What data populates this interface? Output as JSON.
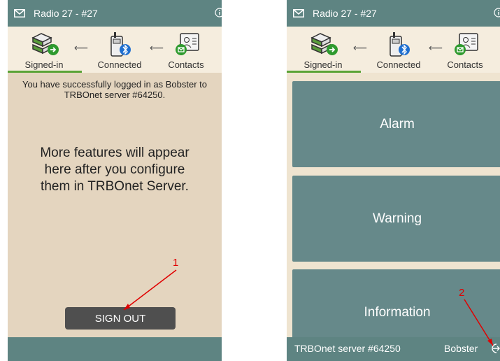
{
  "panels": [
    {
      "title": "Radio 27 - #27",
      "steps": [
        "Signed-in",
        "Connected",
        "Contacts"
      ],
      "success_message": "You have successfully logged in as Bobster to TRBOnet server #64250.",
      "features_message": "More features will appear here after you configure them in TRBOnet Server.",
      "sign_out_label": "SIGN OUT",
      "annotation": "1"
    },
    {
      "title": "Radio 27 - #27",
      "steps": [
        "Signed-in",
        "Connected",
        "Contacts"
      ],
      "tiles": [
        "Alarm",
        "Warning",
        "Information"
      ],
      "footer": {
        "server": "TRBOnet server #64250",
        "user": "Bobster"
      },
      "annotation": "2"
    }
  ],
  "colors": {
    "teal": "#5e8482",
    "tile": "#66898a",
    "active": "#5aa336",
    "annotation": "#e00000"
  }
}
